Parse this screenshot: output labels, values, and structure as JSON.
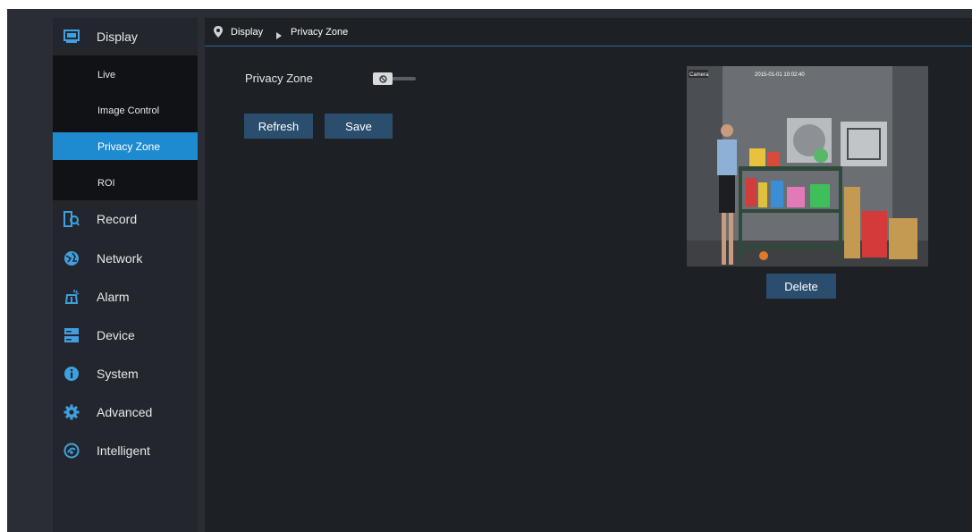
{
  "sidebar": {
    "items": [
      {
        "label": "Display",
        "icon": "monitor-icon"
      },
      {
        "label": "Record",
        "icon": "record-search-icon"
      },
      {
        "label": "Network",
        "icon": "network-globe-icon"
      },
      {
        "label": "Alarm",
        "icon": "alarm-icon"
      },
      {
        "label": "Device",
        "icon": "device-storage-icon"
      },
      {
        "label": "System",
        "icon": "info-icon"
      },
      {
        "label": "Advanced",
        "icon": "gear-icon"
      },
      {
        "label": "Intelligent",
        "icon": "intelligent-icon"
      }
    ],
    "submenu": [
      {
        "label": "Live"
      },
      {
        "label": "Image Control"
      },
      {
        "label": "Privacy Zone",
        "active": true
      },
      {
        "label": "ROI"
      }
    ]
  },
  "breadcrumb": {
    "parent": "Display",
    "current": "Privacy Zone"
  },
  "main": {
    "privacy_zone_label": "Privacy Zone",
    "privacy_zone_enabled": false,
    "refresh_label": "Refresh",
    "save_label": "Save",
    "delete_label": "Delete",
    "preview_channel_label": "Camera",
    "preview_timestamp": "2015-01-01 10:02:40"
  },
  "colors": {
    "accent": "#1e8bd0",
    "button": "#2b4e6e",
    "sidebar": "#23272d",
    "submenu": "#101215",
    "main_bg": "#1d2025"
  }
}
